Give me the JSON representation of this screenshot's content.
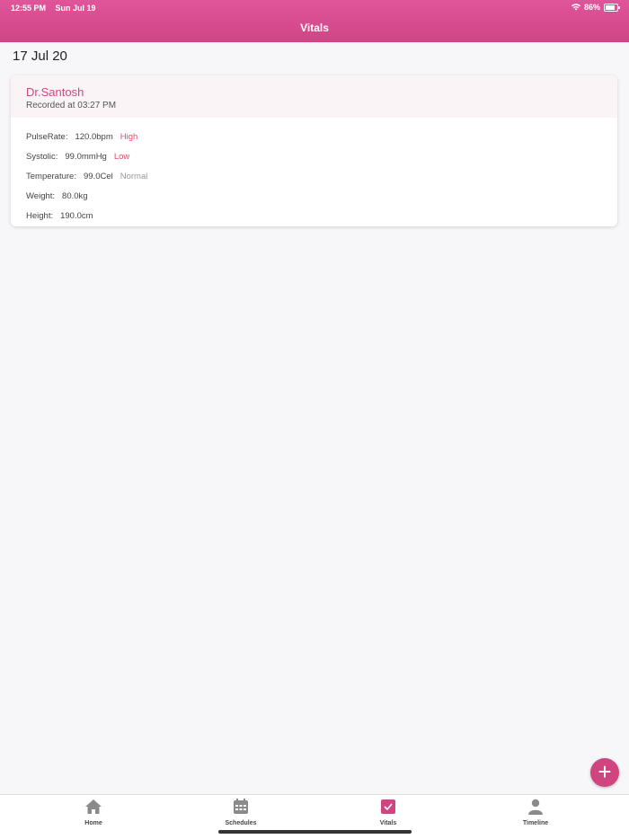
{
  "status_bar": {
    "time": "12:55 PM",
    "date": "Sun Jul 19",
    "battery": "86%"
  },
  "header": {
    "title": "Vitals"
  },
  "date_label": "17 Jul 20",
  "card": {
    "doctor": "Dr.Santosh",
    "recorded": "Recorded at 03:27 PM",
    "vitals": [
      {
        "label": "PulseRate:",
        "value": "120.0bpm",
        "status": "High"
      },
      {
        "label": "Systolic:",
        "value": "99.0mmHg",
        "status": "Low"
      },
      {
        "label": "Temperature:",
        "value": "99.0Cel",
        "status": "Normal"
      },
      {
        "label": "Weight:",
        "value": "80.0kg",
        "status": ""
      },
      {
        "label": "Height:",
        "value": "190.0cm",
        "status": ""
      }
    ]
  },
  "fab": {
    "icon": "plus-icon",
    "label": "+"
  },
  "tabs": [
    {
      "label": "Home",
      "icon": "home-icon"
    },
    {
      "label": "Schedules",
      "icon": "calendar-icon"
    },
    {
      "label": "Vitals",
      "icon": "checkbox-icon"
    },
    {
      "label": "Timeline",
      "icon": "person-icon"
    }
  ],
  "colors": {
    "accent": "#d0457f",
    "status_alert": "#e54a6a",
    "status_normal": "#999999"
  }
}
